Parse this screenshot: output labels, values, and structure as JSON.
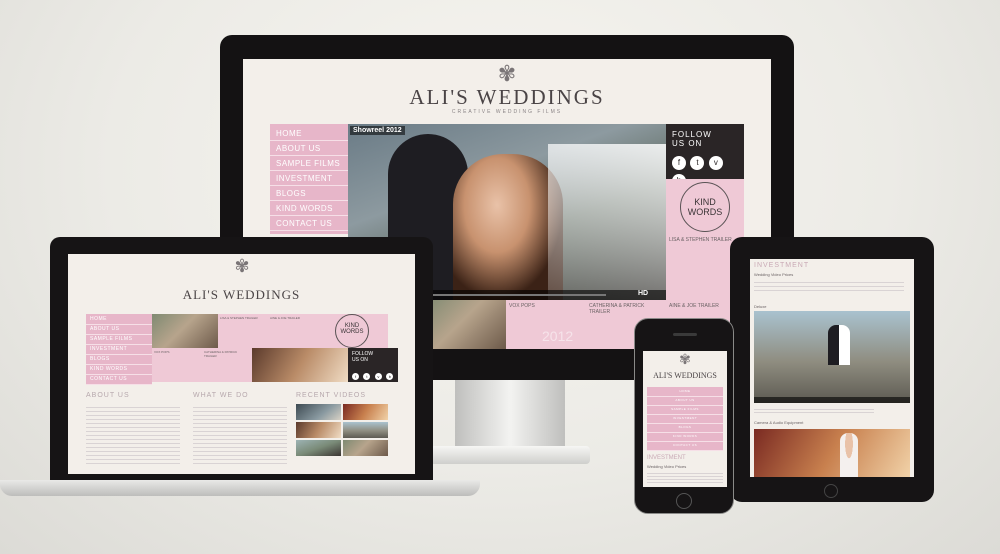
{
  "brand": {
    "title": "ALI'S WEDDINGS",
    "tagline": "CREATIVE WEDDING FILMS"
  },
  "nav": {
    "items": [
      "HOME",
      "ABOUT US",
      "SAMPLE FILMS",
      "INVESTMENT",
      "BLOGS",
      "KIND WORDS",
      "CONTACT US"
    ]
  },
  "hero": {
    "video_label": "Showreel 2012",
    "hd_label": "HD"
  },
  "follow": {
    "label_line1": "FOLLOW",
    "label_line2": "US ON",
    "icons": [
      "f",
      "t",
      "v",
      "b"
    ]
  },
  "kind_words": {
    "line1": "KIND",
    "line2": "WORDS"
  },
  "thumbs": {
    "t1": "LISA & STEPHEN TRAILER",
    "t2": "VOX POPS",
    "t3": "CATHERINA & PATRICK TRAILER",
    "t4": "AINE & JOE TRAILER",
    "t5": "2012"
  },
  "laptop": {
    "about": "ABOUT US",
    "what": "WHAT WE DO",
    "recent": "RECENT VIDEOS",
    "follow1": "FOLLOW",
    "follow2": "US ON",
    "thumb1": "LISA & STEPHEN TRAILER",
    "thumb2": "AINE & JOE TRAILER",
    "thumb3": "VOX POPS",
    "thumb4": "CATHERINA & PATRICK TRAILER"
  },
  "tablet": {
    "heading": "INVESTMENT",
    "sub": "Wedding Video Prices",
    "label1": "Deluxe",
    "label2": "Camera & Audio Equipment"
  },
  "phone": {
    "title": "ALI'S WEDDINGS",
    "heading": "INVESTMENT",
    "sub": "Wedding Video Prices"
  },
  "colors": {
    "pink": "#e7b6c9",
    "dark": "#2a2526",
    "cream": "#f3efea"
  }
}
